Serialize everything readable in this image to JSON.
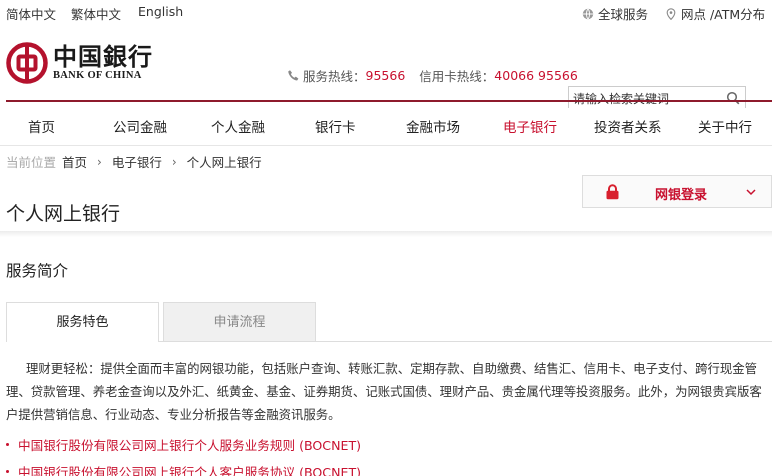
{
  "topbar": {
    "lang_simplified": "简体中文",
    "lang_traditional": "繁体中文",
    "lang_english": "English",
    "global_service": "全球服务",
    "branches_atm": "网点 /ATM分布"
  },
  "header": {
    "logo_cn": "中国銀行",
    "logo_en": "BANK OF CHINA",
    "service_hotline_label": "服务热线：",
    "service_hotline_number": "95566",
    "card_hotline_label": "信用卡热线：",
    "card_hotline_number": "40066 95566",
    "search_placeholder": "请输入检索关键词"
  },
  "nav": {
    "items": [
      {
        "label": "首页"
      },
      {
        "label": "公司金融"
      },
      {
        "label": "个人金融"
      },
      {
        "label": "银行卡"
      },
      {
        "label": "金融市场"
      },
      {
        "label": "电子银行"
      },
      {
        "label": "投资者关系"
      },
      {
        "label": "关于中行"
      }
    ],
    "active_index": 5
  },
  "breadcrumb": {
    "prefix": "当前位置",
    "items": [
      "首页",
      "电子银行",
      "个人网上银行"
    ],
    "separator": "›"
  },
  "page": {
    "title": "个人网上银行",
    "login_label": "网银登录"
  },
  "section": {
    "title": "服务简介",
    "tabs": [
      "服务特色",
      "申请流程"
    ],
    "description": "理财更轻松：提供全面而丰富的网银功能，包括账户查询、转账汇款、定期存款、自助缴费、结售汇、信用卡、电子支付、跨行现金管理、贷款管理、养老金查询以及外汇、纸黄金、基金、证券期货、记账式国债、理财产品、贵金属代理等投资服务。此外，为网银贵宾版客户提供营销信息、行业动态、专业分析报告等金融资讯服务。",
    "links": [
      "中国银行股份有限公司网上银行个人服务业务规则 (BOCNET)",
      "中国银行股份有限公司网上银行个人客户服务协议 (BOCNET)"
    ]
  },
  "colors": {
    "brand_red": "#c8112f",
    "rule_maroon": "#8e1a2c"
  }
}
